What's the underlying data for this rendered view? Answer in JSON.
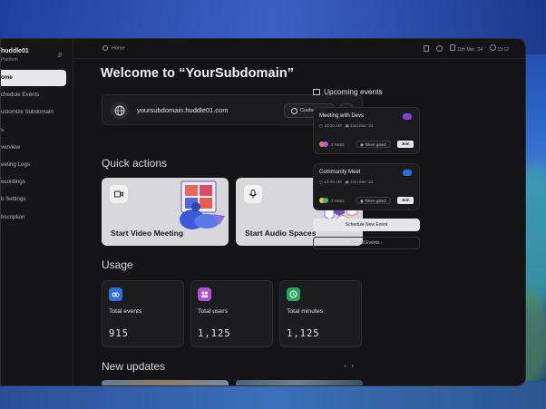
{
  "sidebar": {
    "brand_name": "huddle01",
    "brand_sub": "Platform",
    "items": [
      {
        "label": "ome",
        "active": true
      },
      {
        "label": "chedule Events",
        "active": false
      },
      {
        "label": "ustomize Subdomain",
        "active": false
      },
      {
        "label": "s",
        "active": false
      },
      {
        "label": "verview",
        "active": false
      },
      {
        "label": "eeting Logs",
        "active": false
      },
      {
        "label": "ecordings",
        "active": false
      },
      {
        "label": "b Settings",
        "active": false
      },
      {
        "label": "bscription",
        "active": false
      }
    ]
  },
  "topbar": {
    "breadcrumb": "Home",
    "date": "11th Mar, '24",
    "time": "13:12"
  },
  "main": {
    "title": "Welcome to “YourSubdomain”",
    "domain": "yoursubdomain.huddle01.com",
    "customize_label": "Customize",
    "quick_actions_title": "Quick actions",
    "quick_actions": [
      {
        "label": "Start Video Meeting",
        "icon": "video-camera-icon"
      },
      {
        "label": "Start Audio Spaces",
        "icon": "microphone-icon"
      }
    ],
    "usage_title": "Usage",
    "usage": [
      {
        "label": "Total events",
        "value": "915",
        "icon": "events-icon",
        "color": "#2f6fe0"
      },
      {
        "label": "Total users",
        "value": "1,125",
        "icon": "users-icon",
        "color": "#b24fd6"
      },
      {
        "label": "Total minutes",
        "value": "1,125",
        "icon": "clock-icon",
        "color": "#27a560"
      }
    ],
    "updates_title": "New updates"
  },
  "events": {
    "title": "Upcoming events",
    "items": [
      {
        "name": "Meeting with Devs",
        "time": "10:30 AM",
        "date": "21st Mar '24",
        "hosts": "2 Hosts",
        "access": "Token-gated",
        "join": "Join",
        "badge_color": "#7a45d6"
      },
      {
        "name": "Community Meet",
        "time": "10:30 AM",
        "date": "21st Mar '24",
        "hosts": "2 Hosts",
        "access": "Token-gated",
        "join": "Join",
        "badge_color": "#2d6fd6"
      }
    ],
    "schedule_label": "Schedule New Event",
    "see_all_label": "See all Events"
  }
}
